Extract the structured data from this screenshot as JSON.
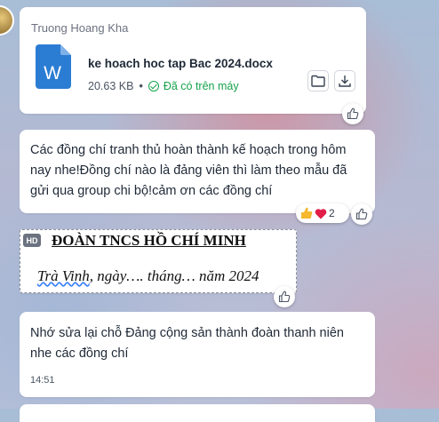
{
  "file_message": {
    "sender": "Truong Hoang Kha",
    "file_name": "ke hoach hoc tap Bac 2024.docx",
    "file_size": "20.63 KB",
    "separator": "•",
    "status": "Đã có trên máy",
    "icon_letter": "W"
  },
  "message1": {
    "lines": [
      "Các đồng chí tranh thủ hoàn thành kế hoạch trong hôm",
      "nay nhe!Đồng chí nào là đảng viên thì làm theo mẫu đã",
      "gửi qua group chi bộ!cảm ơn các đồng chí"
    ],
    "reaction_count": "2"
  },
  "image_message": {
    "badge": "HD",
    "title": "ĐOÀN TNCS HỒ CHÍ MINH",
    "date_underlined": "Trà Vinh",
    "date_rest": ", ngày…. tháng… năm 2024"
  },
  "message2": {
    "lines": [
      "Nhớ sửa lại chỗ Đảng cộng sản thành đoàn thanh niên",
      "nhe các đồng chí"
    ],
    "time": "14:51"
  },
  "colors": {
    "word_blue": "#2b7cd3",
    "saved_green": "#16a34a",
    "reaction_heart": "#e11d48",
    "reaction_like": "#f5b82e"
  }
}
